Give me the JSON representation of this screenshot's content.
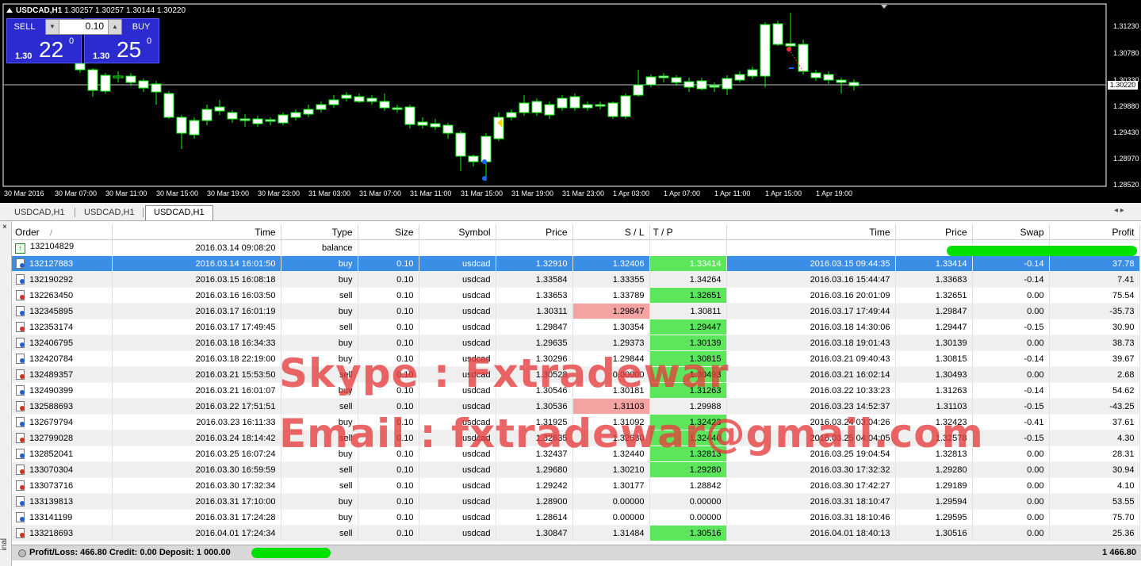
{
  "chart": {
    "title": "USDCAD,H1",
    "ohlc": "1.30257 1.30257 1.30144 1.30220",
    "sell_label": "SELL",
    "buy_label": "BUY",
    "lot": "0.10",
    "sell_prefix": "1.30",
    "sell_big": "22",
    "sell_sup": "0",
    "buy_prefix": "1.30",
    "buy_big": "25",
    "buy_sup": "0",
    "current_price": "1.30220",
    "price_labels": [
      "1.31230",
      "1.30780",
      "1.30330",
      "1.29880",
      "1.29430",
      "1.28970",
      "1.28520"
    ],
    "time_labels": [
      "30 Mar 2016",
      "30 Mar 07:00",
      "30 Mar 11:00",
      "30 Mar 15:00",
      "30 Mar 19:00",
      "30 Mar 23:00",
      "31 Mar 03:00",
      "31 Mar 07:00",
      "31 Mar 11:00",
      "31 Mar 15:00",
      "31 Mar 19:00",
      "31 Mar 23:00",
      "1 Apr 03:00",
      "1 Apr 07:00",
      "1 Apr 11:00",
      "1 Apr 15:00",
      "1 Apr 19:00"
    ]
  },
  "tabs": [
    "USDCAD,H1",
    "USDCAD,H1",
    "USDCAD,H1"
  ],
  "tab_nav": "◂ ▸",
  "terminal": {
    "close": "×",
    "side_label": "inal",
    "columns": [
      "Order",
      "Time",
      "Type",
      "Size",
      "Symbol",
      "Price",
      "S / L",
      "T / P",
      "Time",
      "Price",
      "Swap",
      "Profit"
    ],
    "sort_mark": "/",
    "balance_row": {
      "order": "132104829",
      "time": "2016.03.14 09:08:20",
      "type": "balance"
    },
    "rows": [
      {
        "order": "132127883",
        "time": "2016.03.14 16:01:50",
        "type": "buy",
        "size": "0.10",
        "symbol": "usdcad",
        "price": "1.32910",
        "sl": "1.32406",
        "tp": "1.33414",
        "ctime": "2016.03.15 09:44:35",
        "cprice": "1.33414",
        "swap": "-0.14",
        "profit": "37.78"
      },
      {
        "order": "132190292",
        "time": "2016.03.15 16:08:18",
        "type": "buy",
        "size": "0.10",
        "symbol": "usdcad",
        "price": "1.33584",
        "sl": "1.33355",
        "tp": "1.34264",
        "ctime": "2016.03.16 15:44:47",
        "cprice": "1.33683",
        "swap": "-0.14",
        "profit": "7.41"
      },
      {
        "order": "132263450",
        "time": "2016.03.16 16:03:50",
        "type": "sell",
        "size": "0.10",
        "symbol": "usdcad",
        "price": "1.33653",
        "sl": "1.33789",
        "tp": "1.32651",
        "ctime": "2016.03.16 20:01:09",
        "cprice": "1.32651",
        "swap": "0.00",
        "profit": "75.54"
      },
      {
        "order": "132345895",
        "time": "2016.03.17 16:01:19",
        "type": "buy",
        "size": "0.10",
        "symbol": "usdcad",
        "price": "1.30311",
        "sl": "1.29847",
        "tp": "1.30811",
        "ctime": "2016.03.17 17:49:44",
        "cprice": "1.29847",
        "swap": "0.00",
        "profit": "-35.73"
      },
      {
        "order": "132353174",
        "time": "2016.03.17 17:49:45",
        "type": "sell",
        "size": "0.10",
        "symbol": "usdcad",
        "price": "1.29847",
        "sl": "1.30354",
        "tp": "1.29447",
        "ctime": "2016.03.18 14:30:06",
        "cprice": "1.29447",
        "swap": "-0.15",
        "profit": "30.90"
      },
      {
        "order": "132406795",
        "time": "2016.03.18 16:34:33",
        "type": "buy",
        "size": "0.10",
        "symbol": "usdcad",
        "price": "1.29635",
        "sl": "1.29373",
        "tp": "1.30139",
        "ctime": "2016.03.18 19:01:43",
        "cprice": "1.30139",
        "swap": "0.00",
        "profit": "38.73"
      },
      {
        "order": "132420784",
        "time": "2016.03.18 22:19:00",
        "type": "buy",
        "size": "0.10",
        "symbol": "usdcad",
        "price": "1.30296",
        "sl": "1.29844",
        "tp": "1.30815",
        "ctime": "2016.03.21 09:40:43",
        "cprice": "1.30815",
        "swap": "-0.14",
        "profit": "39.67"
      },
      {
        "order": "132489357",
        "time": "2016.03.21 15:53:50",
        "type": "sell",
        "size": "0.10",
        "symbol": "usdcad",
        "price": "1.30528",
        "sl": "0.00000",
        "tp": "1.30493",
        "ctime": "2016.03.21 16:02:14",
        "cprice": "1.30493",
        "swap": "0.00",
        "profit": "2.68"
      },
      {
        "order": "132490399",
        "time": "2016.03.21 16:01:07",
        "type": "buy",
        "size": "0.10",
        "symbol": "usdcad",
        "price": "1.30546",
        "sl": "1.30181",
        "tp": "1.31263",
        "ctime": "2016.03.22 10:33:23",
        "cprice": "1.31263",
        "swap": "-0.14",
        "profit": "54.62"
      },
      {
        "order": "132588693",
        "time": "2016.03.22 17:51:51",
        "type": "sell",
        "size": "0.10",
        "symbol": "usdcad",
        "price": "1.30536",
        "sl": "1.31103",
        "tp": "1.29988",
        "ctime": "2016.03.23 14:52:37",
        "cprice": "1.31103",
        "swap": "-0.15",
        "profit": "-43.25"
      },
      {
        "order": "132679794",
        "time": "2016.03.23 16:11:33",
        "type": "buy",
        "size": "0.10",
        "symbol": "usdcad",
        "price": "1.31925",
        "sl": "1.31092",
        "tp": "1.32423",
        "ctime": "2016.03.24 03:04:26",
        "cprice": "1.32423",
        "swap": "-0.41",
        "profit": "37.61"
      },
      {
        "order": "132799028",
        "time": "2016.03.24 18:14:42",
        "type": "sell",
        "size": "0.10",
        "symbol": "usdcad",
        "price": "1.32635",
        "sl": "1.32630",
        "tp": "1.32440",
        "ctime": "2016.03.25 04:04:05",
        "cprice": "1.32578",
        "swap": "-0.15",
        "profit": "4.30"
      },
      {
        "order": "132852041",
        "time": "2016.03.25 16:07:24",
        "type": "buy",
        "size": "0.10",
        "symbol": "usdcad",
        "price": "1.32437",
        "sl": "1.32440",
        "tp": "1.32813",
        "ctime": "2016.03.25 19:04:54",
        "cprice": "1.32813",
        "swap": "0.00",
        "profit": "28.31"
      },
      {
        "order": "133070304",
        "time": "2016.03.30 16:59:59",
        "type": "sell",
        "size": "0.10",
        "symbol": "usdcad",
        "price": "1.29680",
        "sl": "1.30210",
        "tp": "1.29280",
        "ctime": "2016.03.30 17:32:32",
        "cprice": "1.29280",
        "swap": "0.00",
        "profit": "30.94"
      },
      {
        "order": "133073716",
        "time": "2016.03.30 17:32:34",
        "type": "sell",
        "size": "0.10",
        "symbol": "usdcad",
        "price": "1.29242",
        "sl": "1.30177",
        "tp": "1.28842",
        "ctime": "2016.03.30 17:42:27",
        "cprice": "1.29189",
        "swap": "0.00",
        "profit": "4.10"
      },
      {
        "order": "133139813",
        "time": "2016.03.31 17:10:00",
        "type": "buy",
        "size": "0.10",
        "symbol": "usdcad",
        "price": "1.28900",
        "sl": "0.00000",
        "tp": "0.00000",
        "ctime": "2016.03.31 18:10:47",
        "cprice": "1.29594",
        "swap": "0.00",
        "profit": "53.55"
      },
      {
        "order": "133141199",
        "time": "2016.03.31 17:24:28",
        "type": "buy",
        "size": "0.10",
        "symbol": "usdcad",
        "price": "1.28614",
        "sl": "0.00000",
        "tp": "0.00000",
        "ctime": "2016.03.31 18:10:46",
        "cprice": "1.29595",
        "swap": "0.00",
        "profit": "75.70"
      },
      {
        "order": "133218693",
        "time": "2016.04.01 17:24:34",
        "type": "sell",
        "size": "0.10",
        "symbol": "usdcad",
        "price": "1.30847",
        "sl": "1.31484",
        "tp": "1.30516",
        "ctime": "2016.04.01 18:40:13",
        "cprice": "1.30516",
        "swap": "0.00",
        "profit": "25.36"
      }
    ],
    "green_sl": [],
    "highlight": {
      "gtp": [
        0,
        2,
        4,
        5,
        6,
        7,
        8,
        10,
        11,
        12,
        13,
        17
      ],
      "rsl": [
        3,
        9
      ],
      "gsl": []
    },
    "summary": {
      "text": "Profit/Loss: 466.80  Credit: 0.00  Deposit: 1 000.00",
      "total": "1 466.80"
    }
  },
  "watermark": {
    "line1": "Skype : Fxtradewar",
    "line2": "Email : fxtradewar@gmail.com"
  },
  "colors": {
    "bull": "#00ff00",
    "panel": "#2b2bd0",
    "selected_row": "#3a8ee6",
    "tp_hit": "#5ce65c",
    "sl_hit": "#f4a3a3",
    "watermark": "#e63c3c"
  }
}
